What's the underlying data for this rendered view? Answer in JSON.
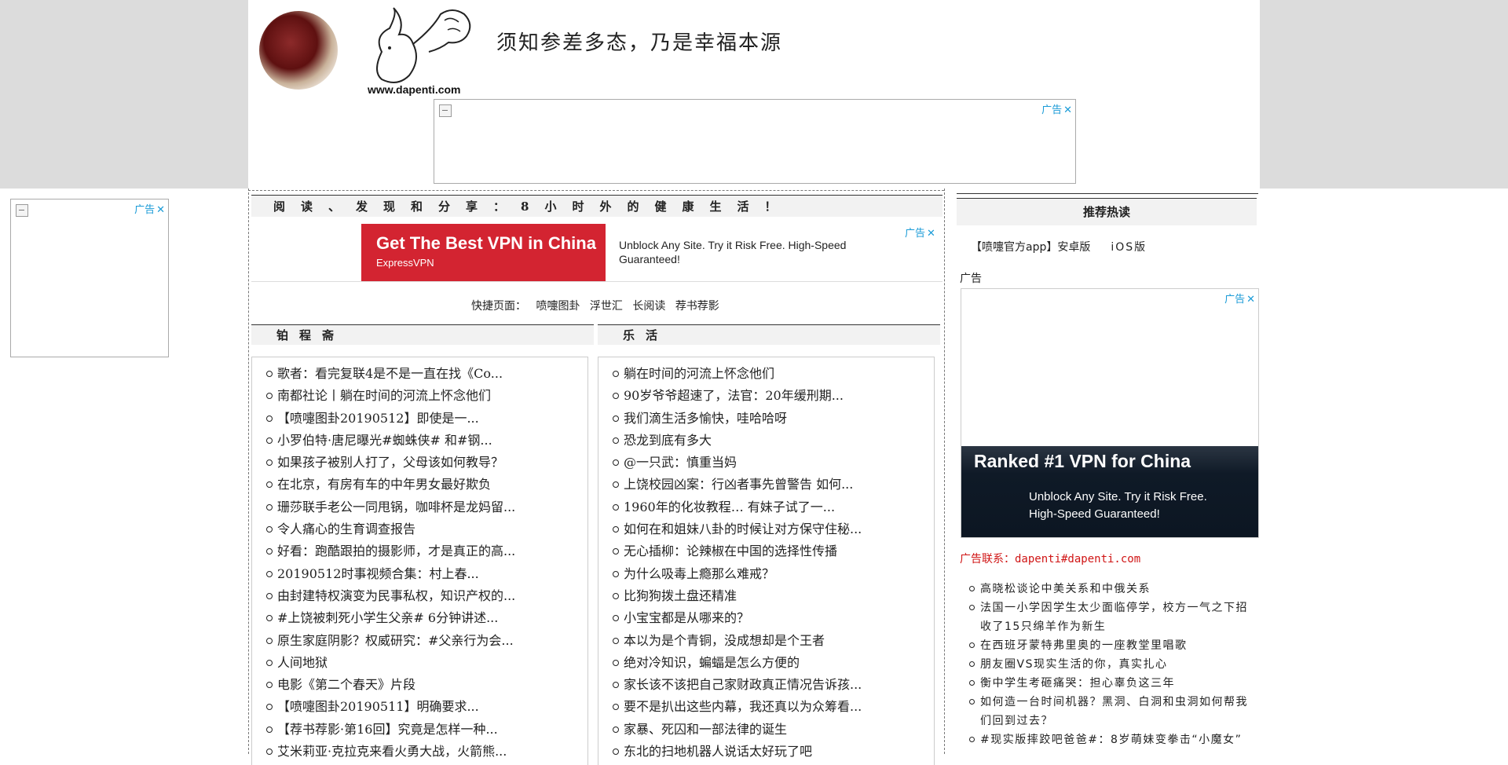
{
  "header": {
    "logo_url": "www.dapenti.com",
    "slogan": "须知参差多态，乃是幸福本源"
  },
  "ads": {
    "tag": "广告",
    "close": "✕"
  },
  "banner": {
    "text": "阅读、发现和分享：8小时外的健康生活！"
  },
  "vpn_banner": {
    "headline": "Get The Best VPN in China",
    "brand": "ExpressVPN",
    "body": "Unblock Any Site. Try it Risk Free. High-Speed Guaranteed!"
  },
  "quick_links": {
    "label": "快捷页面：",
    "items": [
      "喷嚏图卦",
      "浮世汇",
      "长阅读",
      "荐书荐影"
    ]
  },
  "left_section": {
    "title": "铂程斋",
    "items": [
      "歌者：看完复联4是不是一直在找《Co...",
      "南都社论丨躺在时间的河流上怀念他们",
      "【喷嚏图卦20190512】即使是一...",
      "小罗伯特·唐尼曝光#蜘蛛侠# 和#钢...",
      "如果孩子被别人打了，父母该如何教导？",
      "在北京，有房有车的中年男女最好欺负",
      "珊莎联手老公一同甩锅，咖啡杯是龙妈留...",
      "令人痛心的生育调查报告",
      "好看：跑酷跟拍的摄影师，才是真正的高...",
      "20190512时事视频合集：村上春...",
      "由封建特权演变为民事私权，知识产权的...",
      "#上饶被刺死小学生父亲# 6分钟讲述...",
      "原生家庭阴影？权威研究：#父亲行为会...",
      "人间地狱",
      "电影《第二个春天》片段",
      "【喷嚏图卦20190511】明确要求...",
      "【荐书荐影·第16回】究竟是怎样一种...",
      "艾米莉亚·克拉克来看火勇大战，火箭熊..."
    ]
  },
  "right_section": {
    "title": "乐活",
    "items": [
      "躺在时间的河流上怀念他们",
      "90岁爷爷超速了，法官：20年缓刑期...",
      "我们滴生活多愉快，哇哈哈呀",
      "恐龙到底有多大",
      "@一只武：慎重当妈",
      "上饶校园凶案：行凶者事先曾警告 如何...",
      "1960年的化妆教程… 有妹子试了一...",
      "如何在和姐妹八卦的时候让对方保守住秘...",
      "无心插柳：论辣椒在中国的选择性传播",
      "为什么吸毒上瘾那么难戒？",
      "比狗狗拨土盘还精准",
      "小宝宝都是从哪来的？",
      "本以为是个青铜，没成想却是个王者",
      "绝对冷知识，蝙蝠是怎么方便的",
      "家长该不该把自己家财政真正情况告诉孩...",
      "要不是扒出这些内幕，我还真以为众筹看...",
      "家暴、死囚和一部法律的诞生",
      "东北的扫地机器人说话太好玩了吧"
    ]
  },
  "sidebar": {
    "title": "推荐热读",
    "app_label": "【喷嚏官方app】安卓版",
    "ios_label": "iOS版",
    "ad_label": "广告",
    "vpn_ad": {
      "headline": "Ranked #1 VPN for China",
      "body": "Unblock Any Site. Try it Risk Free. High-Speed Guaranteed!"
    },
    "contact": "广告联系：dapenti#dapenti.com",
    "hot_items": [
      "高晓松谈论中美关系和中俄关系",
      "法国一小学因学生太少面临停学，校方一气之下招收了15只绵羊作为新生",
      "在西班牙蒙特弗里奥的一座教堂里唱歌",
      "朋友圈VS现实生活的你，真实扎心",
      "衡中学生考砸痛哭：担心辜负这三年",
      "如何造一台时间机器？黑洞、白洞和虫洞如何帮我们回到过去？",
      "#现实版摔跤吧爸爸#：8岁萌妹变拳击“小魔女”"
    ]
  }
}
